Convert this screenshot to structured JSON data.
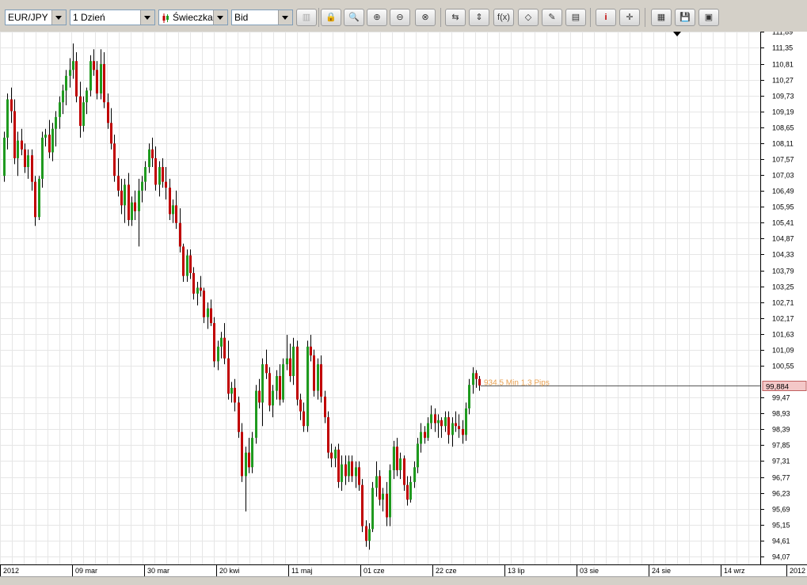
{
  "toolbar": {
    "symbol": "EUR/JPY",
    "period": "1 Dzień",
    "chart_type": "Świeczka",
    "price_side": "Bid",
    "fx_label": "f(x)"
  },
  "colors": {
    "up": "#1f9a1f",
    "down": "#c00000",
    "price_tag": "#f4c8c8",
    "annotation": "#e8a050"
  },
  "current_price": "99,884",
  "annotation": "934.5 Min 1.3 Pips",
  "chart_data": {
    "type": "candlestick",
    "ylim": [
      93.8,
      111.9
    ],
    "y_ticks": [
      "111,89",
      "111,35",
      "110,81",
      "110,27",
      "109,73",
      "109,19",
      "108,65",
      "108,11",
      "107,57",
      "107,03",
      "106,49",
      "105,95",
      "105,41",
      "104,87",
      "104,33",
      "103,79",
      "103,25",
      "102,71",
      "102,17",
      "101,63",
      "101,09",
      "100,55",
      "99,47",
      "98,93",
      "98,39",
      "97,85",
      "97,31",
      "96,77",
      "96,23",
      "95,69",
      "95,15",
      "94,61",
      "94,07"
    ],
    "x_ticks": [
      "2012",
      "09 mar",
      "30 mar",
      "20 kwi",
      "11 maj",
      "01 cze",
      "22 cze",
      "13 lip",
      "03 sie",
      "24 sie",
      "14 wrz",
      "2012"
    ],
    "candles": [
      [
        107,
        108.5,
        106.8,
        108.3
      ],
      [
        108.3,
        109.8,
        107.9,
        109.6
      ],
      [
        109.6,
        110,
        108.8,
        109.2
      ],
      [
        109.2,
        109.6,
        107.4,
        107.6
      ],
      [
        107.6,
        108.5,
        107,
        108.2
      ],
      [
        108.2,
        108.6,
        107.7,
        107.9
      ],
      [
        107.9,
        108.1,
        107.1,
        107.3
      ],
      [
        107.3,
        107.9,
        106.9,
        107.7
      ],
      [
        107.7,
        107.9,
        106.5,
        106.8
      ],
      [
        106.8,
        107,
        105.3,
        105.6
      ],
      [
        105.6,
        107,
        105.5,
        106.9
      ],
      [
        106.9,
        108.5,
        106.6,
        108.3
      ],
      [
        108.3,
        108.6,
        108,
        108.4
      ],
      [
        108.4,
        108.9,
        107.6,
        107.8
      ],
      [
        107.8,
        108.8,
        107.5,
        108.6
      ],
      [
        108.6,
        109.2,
        108,
        109
      ],
      [
        109,
        109.7,
        108.6,
        109.5
      ],
      [
        109.5,
        110.1,
        109.1,
        109.9
      ],
      [
        109.9,
        110.6,
        109.4,
        110.4
      ],
      [
        110.4,
        111,
        110,
        110.6
      ],
      [
        110.6,
        111.5,
        110.3,
        110.9
      ],
      [
        110.9,
        111.2,
        109.5,
        109.7
      ],
      [
        109.7,
        110.2,
        108.3,
        108.7
      ],
      [
        108.7,
        109.7,
        108.5,
        109.5
      ],
      [
        109.5,
        110,
        109.1,
        109.9
      ],
      [
        109.9,
        111.1,
        109.7,
        110.9
      ],
      [
        110.9,
        111.3,
        110.4,
        110.6
      ],
      [
        110.6,
        110.9,
        109.6,
        109.8
      ],
      [
        109.8,
        111.3,
        109.6,
        110.8
      ],
      [
        110.8,
        111.2,
        109.3,
        109.5
      ],
      [
        109.5,
        109.8,
        108.6,
        108.8
      ],
      [
        108.8,
        109.3,
        107.9,
        108.1
      ],
      [
        108.1,
        108.4,
        106.8,
        107
      ],
      [
        107,
        107.6,
        106.3,
        106.5
      ],
      [
        106.5,
        106.9,
        105.7,
        106
      ],
      [
        106,
        106.9,
        105.4,
        106.7
      ],
      [
        106.7,
        107.1,
        105.3,
        105.5
      ],
      [
        105.5,
        106.3,
        105.3,
        106.1
      ],
      [
        106.1,
        106.5,
        105.5,
        105.8
      ],
      [
        105.8,
        106.9,
        104.6,
        106.5
      ],
      [
        106.5,
        107,
        106.1,
        106.8
      ],
      [
        106.8,
        107.5,
        106.5,
        107.3
      ],
      [
        107.3,
        108.1,
        107.1,
        107.9
      ],
      [
        107.9,
        108.3,
        107.3,
        107.6
      ],
      [
        107.6,
        108,
        106.5,
        106.7
      ],
      [
        106.7,
        107.5,
        106.3,
        107.3
      ],
      [
        107.3,
        107.6,
        106.6,
        106.8
      ],
      [
        106.8,
        107.3,
        106.2,
        106.6
      ],
      [
        106.6,
        106.9,
        105.5,
        105.7
      ],
      [
        105.7,
        106.2,
        105.4,
        106
      ],
      [
        106,
        106.5,
        105.2,
        105.4
      ],
      [
        105.4,
        105.9,
        104.4,
        104.6
      ],
      [
        104.6,
        104.7,
        103.4,
        103.6
      ],
      [
        103.6,
        104.5,
        103.4,
        104.3
      ],
      [
        104.3,
        104.5,
        103.5,
        103.7
      ],
      [
        103.7,
        103.9,
        102.8,
        103
      ],
      [
        103,
        103.4,
        102.6,
        103.2
      ],
      [
        103.2,
        103.6,
        102.9,
        103.1
      ],
      [
        103.1,
        103.2,
        102,
        102.2
      ],
      [
        102.2,
        102.7,
        101.8,
        102.5
      ],
      [
        102.5,
        102.8,
        101.9,
        102
      ],
      [
        102,
        102.2,
        100.5,
        100.7
      ],
      [
        100.7,
        101.4,
        100.4,
        101.2
      ],
      [
        101.2,
        101.7,
        100.8,
        101.5
      ],
      [
        101.5,
        102,
        100.6,
        100.8
      ],
      [
        100.8,
        101.4,
        99.4,
        99.6
      ],
      [
        99.6,
        100,
        99.3,
        99.8
      ],
      [
        99.8,
        100.1,
        99,
        99.3
      ],
      [
        99.3,
        99.5,
        98.1,
        98.3
      ],
      [
        98.3,
        98.6,
        96.6,
        96.8
      ],
      [
        96.8,
        97.8,
        95.6,
        97.6
      ],
      [
        97.6,
        98.1,
        96.9,
        97.1
      ],
      [
        97.1,
        98.3,
        96.9,
        98.1
      ],
      [
        98.1,
        99.9,
        97.9,
        99.7
      ],
      [
        99.7,
        100.1,
        99.1,
        99.3
      ],
      [
        99.3,
        100.8,
        98.5,
        100.6
      ],
      [
        100.6,
        101.1,
        100.1,
        100.3
      ],
      [
        100.3,
        100.5,
        99,
        99.2
      ],
      [
        99.2,
        99.9,
        98.8,
        99.7
      ],
      [
        99.7,
        100.4,
        99.4,
        100.2
      ],
      [
        100.2,
        100.6,
        99.2,
        99.4
      ],
      [
        99.4,
        100.8,
        99.3,
        100.6
      ],
      [
        100.6,
        101.6,
        100.4,
        100.8
      ],
      [
        100.8,
        101.3,
        100,
        100.2
      ],
      [
        100.2,
        101.5,
        99.9,
        101.2
      ],
      [
        101.2,
        101.4,
        99.2,
        99.4
      ],
      [
        99.4,
        99.6,
        98.7,
        99
      ],
      [
        99,
        99.3,
        98.3,
        98.5
      ],
      [
        98.5,
        101.4,
        98.3,
        101.2
      ],
      [
        101.2,
        101.6,
        100.7,
        100.9
      ],
      [
        100.9,
        101.1,
        99.5,
        99.7
      ],
      [
        99.7,
        100.8,
        99.4,
        100.6
      ],
      [
        100.6,
        100.9,
        99.3,
        99.5
      ],
      [
        99.5,
        99.7,
        98.6,
        98.8
      ],
      [
        98.8,
        99,
        97.4,
        97.6
      ],
      [
        97.6,
        97.9,
        97.1,
        97.4
      ],
      [
        97.4,
        97.8,
        97.1,
        97.7
      ],
      [
        97.7,
        97.9,
        96.4,
        96.6
      ],
      [
        96.6,
        97.5,
        96.3,
        97.2
      ],
      [
        97.2,
        97.5,
        96.5,
        96.8
      ],
      [
        96.8,
        97.5,
        96.6,
        97.3
      ],
      [
        97.3,
        97.5,
        96.6,
        96.8
      ],
      [
        96.8,
        97.3,
        96.4,
        97.1
      ],
      [
        97.1,
        97.3,
        96.3,
        96.5
      ],
      [
        96.5,
        96.7,
        94.9,
        95.1
      ],
      [
        95.1,
        95.3,
        94.4,
        94.6
      ],
      [
        94.6,
        95.2,
        94.3,
        95
      ],
      [
        95,
        96.6,
        94.9,
        96.4
      ],
      [
        96.4,
        97.3,
        96.1,
        96.8
      ],
      [
        96.8,
        97,
        95.8,
        96
      ],
      [
        96,
        96.4,
        95.6,
        96.2
      ],
      [
        96.2,
        96.6,
        95.1,
        95.4
      ],
      [
        95.4,
        97.2,
        95.1,
        97
      ],
      [
        97,
        98,
        96.7,
        97.8
      ],
      [
        97.8,
        98.1,
        96.8,
        97
      ],
      [
        97,
        97.6,
        96.7,
        97.4
      ],
      [
        97.4,
        97.5,
        96.3,
        96.5
      ],
      [
        96.5,
        96.8,
        95.8,
        96
      ],
      [
        96,
        96.8,
        95.9,
        96.6
      ],
      [
        96.6,
        97.3,
        96.4,
        97.1
      ],
      [
        97.1,
        98.1,
        96.9,
        97.9
      ],
      [
        97.9,
        98.6,
        97.6,
        98.3
      ],
      [
        98.3,
        98.5,
        97.9,
        98.1
      ],
      [
        98.1,
        98.8,
        98,
        98.6
      ],
      [
        98.6,
        99.2,
        98.4,
        98.9
      ],
      [
        98.9,
        99.1,
        98.3,
        98.6
      ],
      [
        98.6,
        98.9,
        98.1,
        98.7
      ],
      [
        98.7,
        98.8,
        98.1,
        98.5
      ],
      [
        98.5,
        99,
        98.3,
        98.8
      ],
      [
        98.8,
        99,
        97.9,
        98.2
      ],
      [
        98.2,
        98.8,
        97.8,
        98.6
      ],
      [
        98.6,
        99,
        98.3,
        98.5
      ],
      [
        98.5,
        98.9,
        98.1,
        98.4
      ],
      [
        98.4,
        98.7,
        97.9,
        98.2
      ],
      [
        98.2,
        99.3,
        98,
        99.1
      ],
      [
        99.1,
        100.1,
        98.9,
        99.9
      ],
      [
        99.9,
        100.5,
        99.6,
        100.3
      ],
      [
        100.3,
        100.4,
        99.8,
        100.1
      ],
      [
        100.1,
        100.2,
        99.7,
        99.88
      ]
    ]
  }
}
